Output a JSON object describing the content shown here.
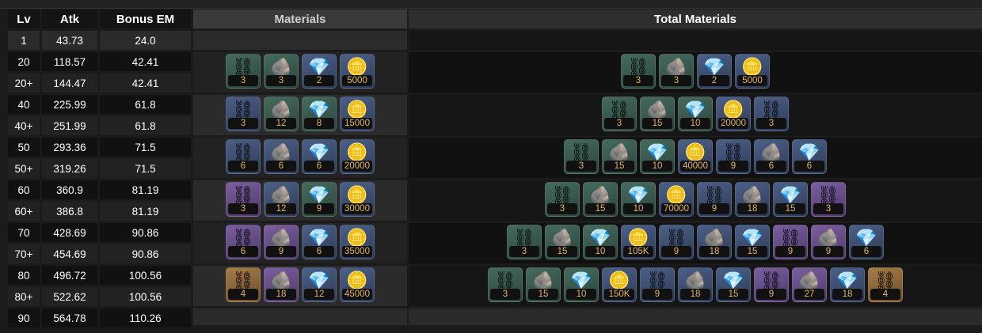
{
  "headers": {
    "lv": "Lv",
    "atk": "Atk",
    "em": "Bonus EM",
    "materials": "Materials",
    "total": "Total Materials"
  },
  "rows": [
    {
      "lv": "1",
      "atk": "43.73",
      "em": "24.0"
    },
    {
      "lv": "20",
      "atk": "118.57",
      "em": "42.41"
    },
    {
      "lv": "20+",
      "atk": "144.47",
      "em": "42.41"
    },
    {
      "lv": "40",
      "atk": "225.99",
      "em": "61.8"
    },
    {
      "lv": "40+",
      "atk": "251.99",
      "em": "61.8"
    },
    {
      "lv": "50",
      "atk": "293.36",
      "em": "71.5"
    },
    {
      "lv": "50+",
      "atk": "319.26",
      "em": "71.5"
    },
    {
      "lv": "60",
      "atk": "360.9",
      "em": "81.19"
    },
    {
      "lv": "60+",
      "atk": "386.8",
      "em": "81.19"
    },
    {
      "lv": "70",
      "atk": "428.69",
      "em": "90.86"
    },
    {
      "lv": "70+",
      "atk": "454.69",
      "em": "90.86"
    },
    {
      "lv": "80",
      "atk": "496.72",
      "em": "100.56"
    },
    {
      "lv": "80+",
      "atk": "522.62",
      "em": "100.56"
    },
    {
      "lv": "90",
      "atk": "564.78",
      "em": "110.26"
    }
  ],
  "materials": [
    [
      {
        "icon": "chain-icon",
        "count": "3",
        "rarity": 2
      },
      {
        "icon": "rock-icon",
        "count": "3",
        "rarity": 2
      },
      {
        "icon": "crystal-icon",
        "count": "2",
        "rarity": 3
      },
      {
        "icon": "mora-coin-icon",
        "count": "5000",
        "rarity": 3
      }
    ],
    [
      {
        "icon": "chain-icon",
        "count": "3",
        "rarity": 3
      },
      {
        "icon": "rock-icon",
        "count": "12",
        "rarity": 2
      },
      {
        "icon": "crystal-icon",
        "count": "8",
        "rarity": 2
      },
      {
        "icon": "mora-coin-icon",
        "count": "15000",
        "rarity": 3
      }
    ],
    [
      {
        "icon": "chain-icon",
        "count": "6",
        "rarity": 3
      },
      {
        "icon": "rock-icon",
        "count": "6",
        "rarity": 3
      },
      {
        "icon": "crystal-icon",
        "count": "6",
        "rarity": 3
      },
      {
        "icon": "mora-coin-icon",
        "count": "20000",
        "rarity": 3
      }
    ],
    [
      {
        "icon": "chain-icon",
        "count": "3",
        "rarity": 4
      },
      {
        "icon": "rock-icon",
        "count": "12",
        "rarity": 3
      },
      {
        "icon": "crystal-icon",
        "count": "9",
        "rarity": 2
      },
      {
        "icon": "mora-coin-icon",
        "count": "30000",
        "rarity": 3
      }
    ],
    [
      {
        "icon": "chain-icon",
        "count": "6",
        "rarity": 4
      },
      {
        "icon": "rock-icon",
        "count": "9",
        "rarity": 4
      },
      {
        "icon": "crystal-icon",
        "count": "6",
        "rarity": 3
      },
      {
        "icon": "mora-coin-icon",
        "count": "35000",
        "rarity": 3
      }
    ],
    [
      {
        "icon": "chain-icon",
        "count": "4",
        "rarity": 5
      },
      {
        "icon": "rock-icon",
        "count": "18",
        "rarity": 4
      },
      {
        "icon": "crystal-icon",
        "count": "12",
        "rarity": 3
      },
      {
        "icon": "mora-coin-icon",
        "count": "45000",
        "rarity": 3
      }
    ]
  ],
  "totals": [
    [
      {
        "icon": "chain-icon",
        "count": "3",
        "rarity": 2
      },
      {
        "icon": "rock-icon",
        "count": "3",
        "rarity": 2
      },
      {
        "icon": "crystal-icon",
        "count": "2",
        "rarity": 3
      },
      {
        "icon": "mora-coin-icon",
        "count": "5000",
        "rarity": 3
      }
    ],
    [
      {
        "icon": "chain-icon",
        "count": "3",
        "rarity": 2
      },
      {
        "icon": "rock-icon",
        "count": "15",
        "rarity": 2
      },
      {
        "icon": "crystal-icon",
        "count": "10",
        "rarity": 2
      },
      {
        "icon": "mora-coin-icon",
        "count": "20000",
        "rarity": 3
      },
      {
        "icon": "chain-icon",
        "count": "3",
        "rarity": 3
      }
    ],
    [
      {
        "icon": "chain-icon",
        "count": "3",
        "rarity": 2
      },
      {
        "icon": "rock-icon",
        "count": "15",
        "rarity": 2
      },
      {
        "icon": "crystal-icon",
        "count": "10",
        "rarity": 2
      },
      {
        "icon": "mora-coin-icon",
        "count": "40000",
        "rarity": 3
      },
      {
        "icon": "chain-icon",
        "count": "9",
        "rarity": 3
      },
      {
        "icon": "rock-icon",
        "count": "6",
        "rarity": 3
      },
      {
        "icon": "crystal-icon",
        "count": "6",
        "rarity": 3
      }
    ],
    [
      {
        "icon": "chain-icon",
        "count": "3",
        "rarity": 2
      },
      {
        "icon": "rock-icon",
        "count": "15",
        "rarity": 2
      },
      {
        "icon": "crystal-icon",
        "count": "10",
        "rarity": 2
      },
      {
        "icon": "mora-coin-icon",
        "count": "70000",
        "rarity": 3
      },
      {
        "icon": "chain-icon",
        "count": "9",
        "rarity": 3
      },
      {
        "icon": "rock-icon",
        "count": "18",
        "rarity": 3
      },
      {
        "icon": "crystal-icon",
        "count": "15",
        "rarity": 3
      },
      {
        "icon": "chain-icon",
        "count": "3",
        "rarity": 4
      }
    ],
    [
      {
        "icon": "chain-icon",
        "count": "3",
        "rarity": 2
      },
      {
        "icon": "rock-icon",
        "count": "15",
        "rarity": 2
      },
      {
        "icon": "crystal-icon",
        "count": "10",
        "rarity": 2
      },
      {
        "icon": "mora-coin-icon",
        "count": "105K",
        "rarity": 3
      },
      {
        "icon": "chain-icon",
        "count": "9",
        "rarity": 3
      },
      {
        "icon": "rock-icon",
        "count": "18",
        "rarity": 3
      },
      {
        "icon": "crystal-icon",
        "count": "15",
        "rarity": 3
      },
      {
        "icon": "chain-icon",
        "count": "9",
        "rarity": 4
      },
      {
        "icon": "rock-icon",
        "count": "9",
        "rarity": 4
      },
      {
        "icon": "crystal-icon",
        "count": "6",
        "rarity": 3
      }
    ],
    [
      {
        "icon": "chain-icon",
        "count": "3",
        "rarity": 2
      },
      {
        "icon": "rock-icon",
        "count": "15",
        "rarity": 2
      },
      {
        "icon": "crystal-icon",
        "count": "10",
        "rarity": 2
      },
      {
        "icon": "mora-coin-icon",
        "count": "150K",
        "rarity": 3
      },
      {
        "icon": "chain-icon",
        "count": "9",
        "rarity": 3
      },
      {
        "icon": "rock-icon",
        "count": "18",
        "rarity": 3
      },
      {
        "icon": "crystal-icon",
        "count": "15",
        "rarity": 3
      },
      {
        "icon": "chain-icon",
        "count": "9",
        "rarity": 4
      },
      {
        "icon": "rock-icon",
        "count": "27",
        "rarity": 4
      },
      {
        "icon": "crystal-icon",
        "count": "18",
        "rarity": 3
      },
      {
        "icon": "chain-icon",
        "count": "4",
        "rarity": 5
      }
    ]
  ]
}
